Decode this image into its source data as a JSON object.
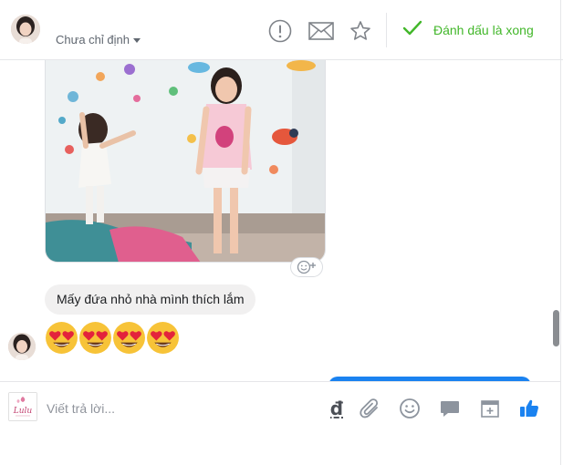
{
  "header": {
    "assign_label": "Chưa chỉ định",
    "done_label": "Đánh dấu là xong",
    "icons": [
      "exclamation-circle-icon",
      "envelope-icon",
      "star-icon",
      "checkmark-icon"
    ],
    "accent_green": "#42b72a"
  },
  "conversation": {
    "incoming_message": "Mấy đứa nhỏ nhà mình thích lắm",
    "emoji_reply": "😍😍😍😍",
    "emoji_count": 4
  },
  "composer": {
    "placeholder": "Viết trả lời...",
    "currency_symbol": "₫",
    "page_logo_text": "Lulu",
    "icons": [
      "dong-currency-icon",
      "paperclip-icon",
      "smiley-icon",
      "chat-bubble-icon",
      "calendar-icon",
      "thumbs-up-icon"
    ],
    "accent_blue": "#1a82f0"
  }
}
